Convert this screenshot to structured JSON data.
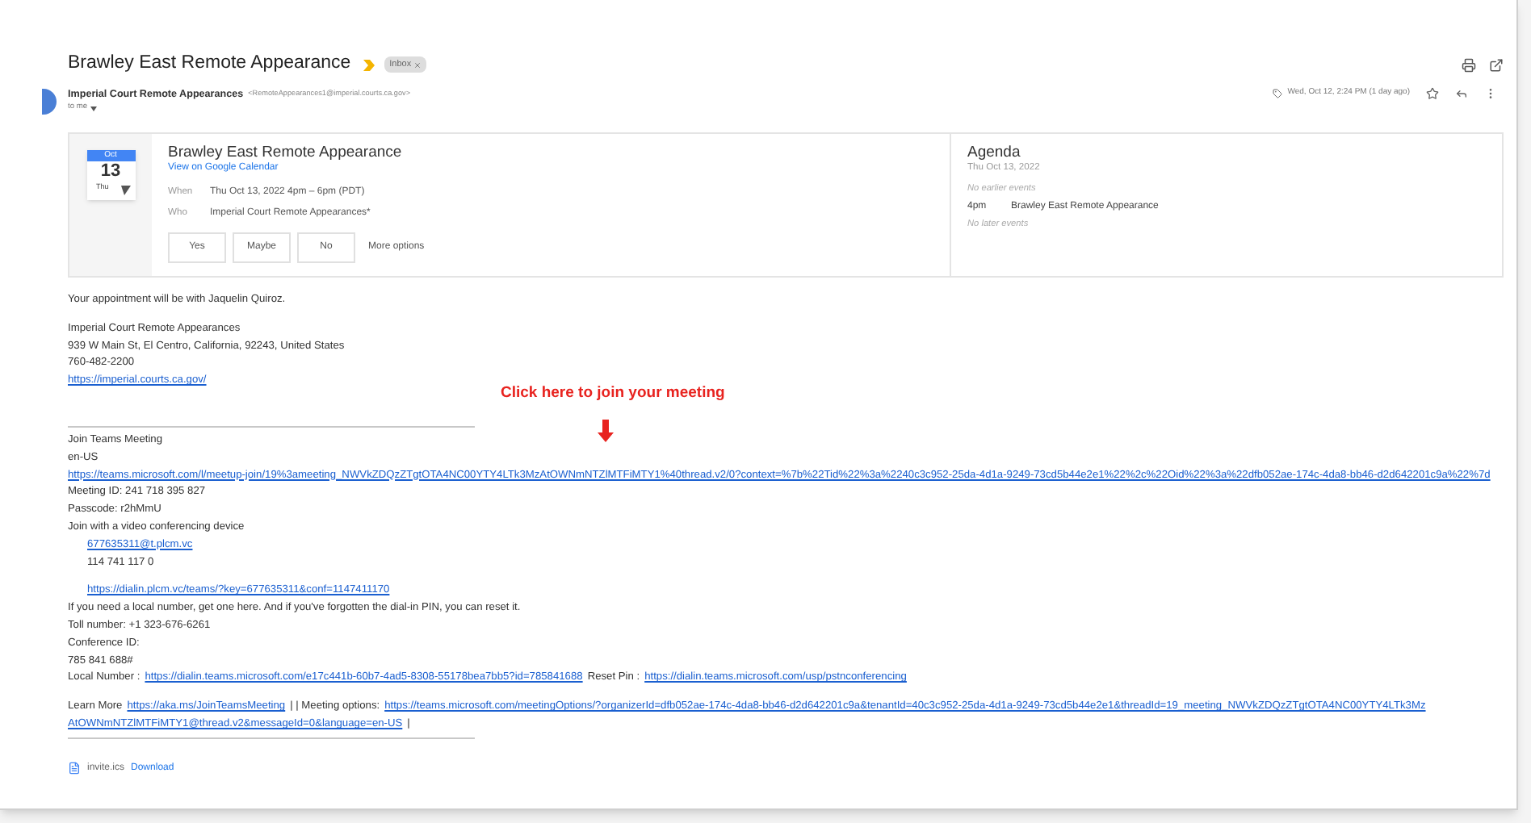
{
  "subject": "Brawley East Remote Appearance",
  "label": "Inbox",
  "sender": {
    "name": "Imperial Court Remote Appearances",
    "email": "<RemoteAppearances1@imperial.courts.ca.gov>",
    "recipient": "to me",
    "date": "Wed, Oct 12, 2:24 PM (1 day ago)"
  },
  "invite": {
    "month": "Oct",
    "day": "13",
    "weekday": "Thu",
    "title": "Brawley East Remote Appearance",
    "calendar_link": "View on Google Calendar",
    "details": [
      {
        "label": "When",
        "value": "Thu Oct 13, 2022 4pm – 6pm (PDT)"
      },
      {
        "label": "Who",
        "value": "Imperial Court Remote Appearances*"
      }
    ],
    "rsvp": [
      "Yes",
      "Maybe",
      "No"
    ],
    "more": "More options"
  },
  "agenda": {
    "title": "Agenda",
    "date": "Thu Oct 13, 2022",
    "events": [
      {
        "kind": "note",
        "text": "No earlier events"
      },
      {
        "kind": "event",
        "time": "4pm",
        "text": "Brawley East Remote Appearance"
      },
      {
        "kind": "note",
        "text": "No later events"
      }
    ]
  },
  "annotation": "Click here to join your meeting",
  "body": [
    {
      "kind": "text",
      "text": "Your appointment will be with Jaquelin Quiroz."
    },
    {
      "kind": "gap"
    },
    {
      "kind": "text",
      "text": "Imperial Court Remote Appearances"
    },
    {
      "kind": "text",
      "text": "939 W Main St, El Centro, California, 92243, United States"
    },
    {
      "kind": "text",
      "text": "760-482-2200"
    },
    {
      "kind": "link",
      "text": "https://imperial.courts.ca.gov/"
    },
    {
      "kind": "biggap"
    },
    {
      "kind": "rule"
    },
    {
      "kind": "text",
      "text": "Join Teams Meeting"
    },
    {
      "kind": "text",
      "text": "en-US"
    },
    {
      "kind": "link",
      "text": "https://teams.microsoft.com/l/meetup-join/19%3ameeting_NWVkZDQzZTgtOTA4NC00YTY4LTk3MzAtOWNmNTZlMTFiMTY1%40thread.v2/0?context=%7b%22Tid%22%3a%2240c3c952-25da-4d1a-9249-73cd5b44e2e1%22%2c%22Oid%22%3a%22dfb052ae-174c-4da8-bb46-d2d642201c9a%22%7d"
    },
    {
      "kind": "text",
      "text": "Meeting ID: 241 718 395 827"
    },
    {
      "kind": "text",
      "text": "Passcode: r2hMmU"
    },
    {
      "kind": "text",
      "text": "Join with a video conferencing device"
    },
    {
      "kind": "indented_link",
      "text": "677635311@t.plcm.vc"
    },
    {
      "kind": "indented_text",
      "text": "114 741 117 0"
    },
    {
      "kind": "gap"
    },
    {
      "kind": "indented_link",
      "text": "https://dialin.plcm.vc/teams/?key=677635311&conf=1147411170"
    },
    {
      "kind": "text",
      "text": "If you need a local number, get one here. And if you've forgotten the dial-in PIN, you can reset it."
    },
    {
      "kind": "text",
      "text": "Toll number: +1 323-676-6261"
    },
    {
      "kind": "text",
      "text": "Conference ID:"
    },
    {
      "kind": "text",
      "text": "785 841 688#"
    },
    {
      "kind": "mixed",
      "parts": [
        {
          "kind": "text",
          "text": "Local Number :"
        },
        {
          "kind": "link",
          "text": "https://dialin.teams.microsoft.com/e17c441b-60b7-4ad5-8308-55178bea7bb5?id=785841688"
        },
        {
          "kind": "text",
          "text": "Reset Pin :"
        },
        {
          "kind": "link",
          "text": "https://dialin.teams.microsoft.com/usp/pstnconferencing"
        }
      ]
    },
    {
      "kind": "gap"
    },
    {
      "kind": "mixed",
      "parts": [
        {
          "kind": "text",
          "text": "Learn More"
        },
        {
          "kind": "link",
          "text": "https://aka.ms/JoinTeamsMeeting"
        },
        {
          "kind": "text",
          "text": "|  | Meeting options:"
        },
        {
          "kind": "link",
          "text": "https://teams.microsoft.com/meetingOptions/?organizerId=dfb052ae-174c-4da8-bb46-d2d642201c9a&tenantId=40c3c952-25da-4d1a-9249-73cd5b44e2e1&threadId=19_meeting_NWVkZDQzZTgtOTA4NC00YTY4LTk3Mz"
        }
      ]
    },
    {
      "kind": "mixed",
      "parts": [
        {
          "kind": "link",
          "text": "AtOWNmNTZlMTFiMTY1@thread.v2&messageId=0&language=en-US"
        },
        {
          "kind": "text",
          "text": "|"
        }
      ]
    },
    {
      "kind": "rule"
    }
  ],
  "attachment": {
    "name": "invite.ics",
    "action": "Download"
  }
}
